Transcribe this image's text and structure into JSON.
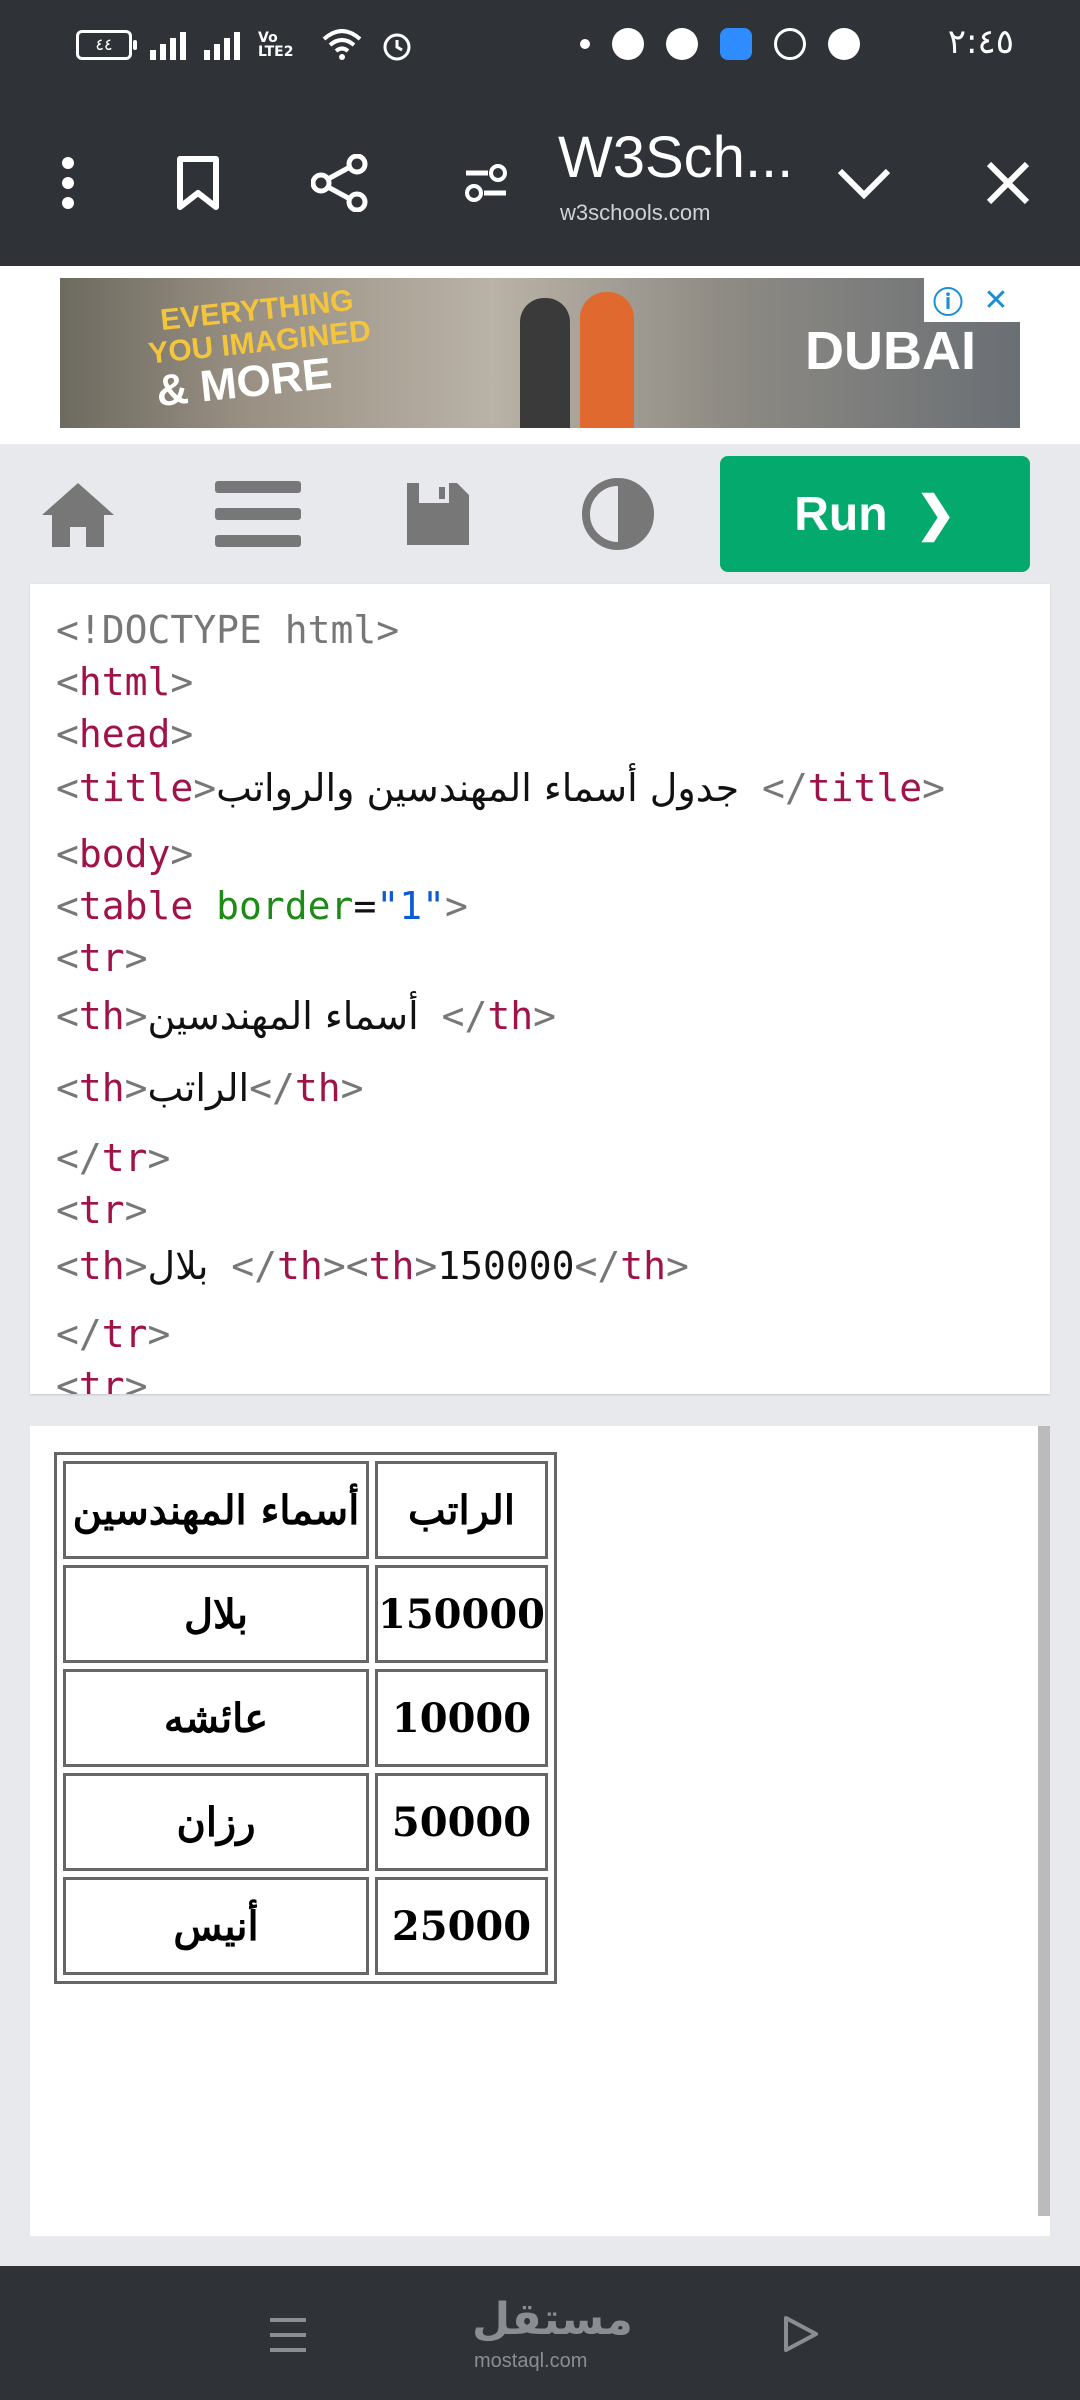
{
  "status_bar": {
    "time": "٢:٤٥",
    "battery": "٤٤",
    "network": "Vo LTE2"
  },
  "browser": {
    "title": "W3Sch...",
    "url": "w3schools.com"
  },
  "ad": {
    "line1": "EVERYTHING",
    "line2": "YOU IMAGINED",
    "line3": "& MORE",
    "brand": "DUBAI",
    "info_glyph": "ⓘ",
    "close_glyph": "✕"
  },
  "editor": {
    "run_label": "Run",
    "run_glyph": "❯"
  },
  "code_lines": [
    {
      "prefix": "<!DOCTYPE html>"
    },
    {
      "tag": "html"
    },
    {
      "tag": "head"
    },
    {
      "tag": "title",
      "text": "جدول أسماء المهندسين والرواتب",
      "close": "title"
    },
    {
      "tag": "body"
    },
    {
      "tag": "table",
      "attr": "border",
      "val": "\"1\""
    },
    {
      "tag": "tr"
    },
    {
      "tag": "th",
      "text": "أسماء المهندسين",
      "close": "th"
    },
    {
      "tag": "th",
      "text": "الراتب",
      "close": "th"
    },
    {
      "close_tag": "tr"
    },
    {
      "tag": "tr"
    },
    {
      "tag": "th",
      "text": "بلال",
      "close": "th",
      "tag2": "th",
      "text2": "150000",
      "close2": "th"
    },
    {
      "close_tag": "tr"
    },
    {
      "tag": "tr"
    }
  ],
  "result_table": {
    "headers": [
      "أسماء المهندسين",
      "الراتب"
    ],
    "rows": [
      [
        "بلال",
        "150000"
      ],
      [
        "عائشه",
        "10000"
      ],
      [
        "رزان",
        "50000"
      ],
      [
        "أنيس",
        "25000"
      ]
    ]
  },
  "navbar": {
    "watermark": "مستقل",
    "watermark_sub": "mostaql.com"
  }
}
